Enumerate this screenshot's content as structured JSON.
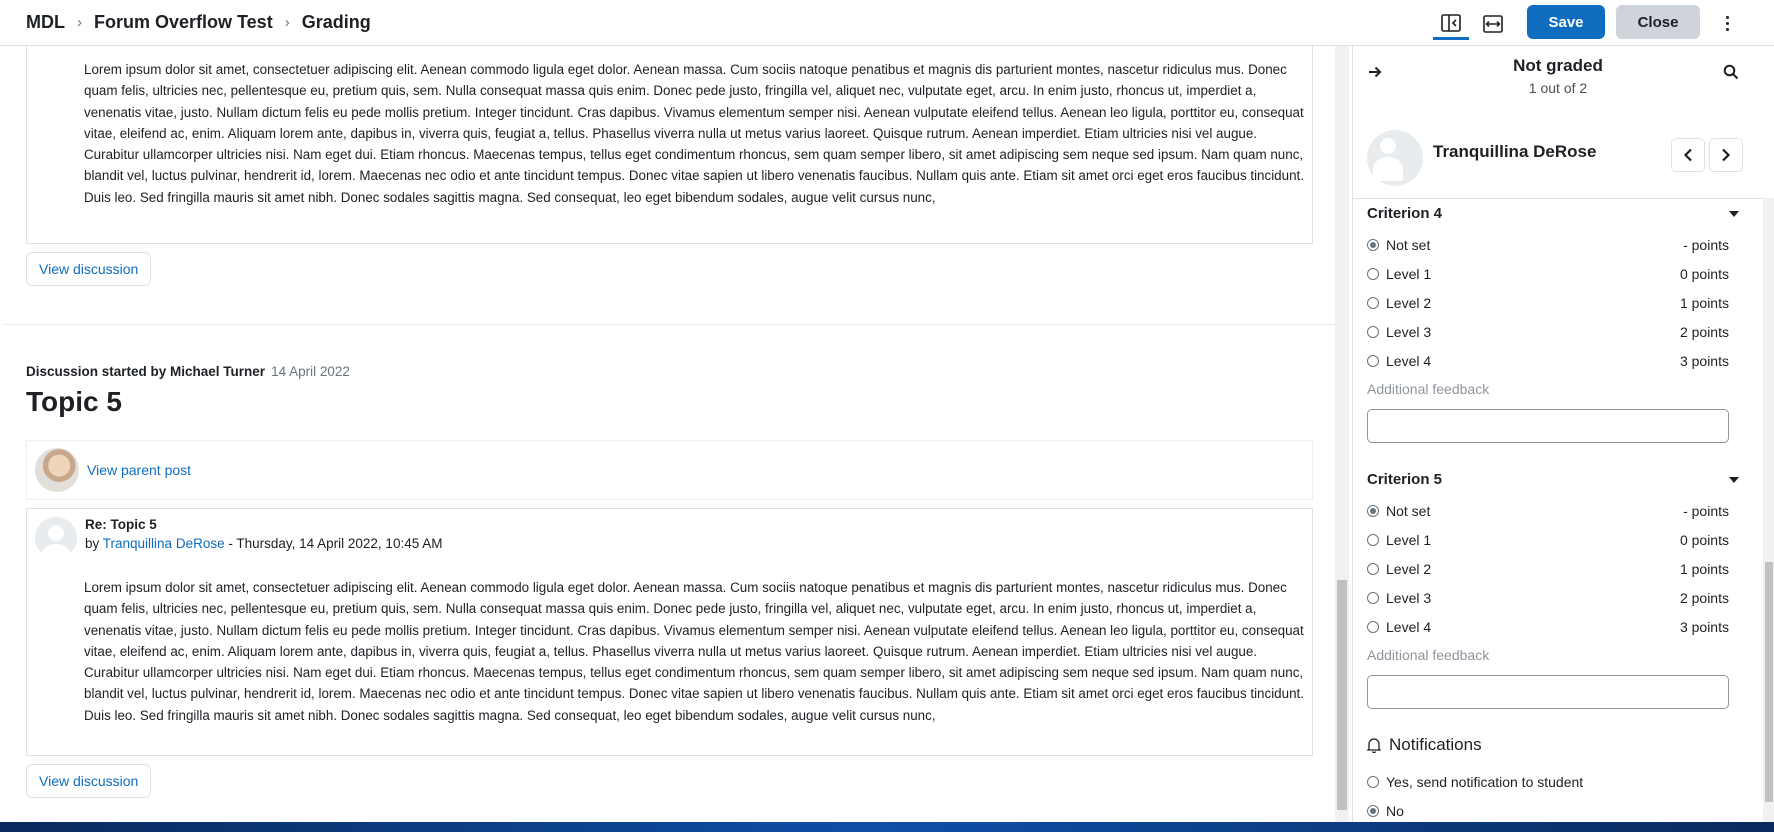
{
  "header": {
    "breadcrumb": [
      "MDL",
      "Forum Overflow Test",
      "Grading"
    ],
    "save_label": "Save",
    "close_label": "Close"
  },
  "main": {
    "post1_body": "Lorem ipsum dolor sit amet, consectetuer adipiscing elit. Aenean commodo ligula eget dolor. Aenean massa. Cum sociis natoque penatibus et magnis dis parturient montes, nascetur ridiculus mus. Donec quam felis, ultricies nec, pellentesque eu, pretium quis, sem. Nulla consequat massa quis enim. Donec pede justo, fringilla vel, aliquet nec, vulputate eget, arcu. In enim justo, rhoncus ut, imperdiet a, venenatis vitae, justo. Nullam dictum felis eu pede mollis pretium. Integer tincidunt. Cras dapibus. Vivamus elementum semper nisi. Aenean vulputate eleifend tellus. Aenean leo ligula, porttitor eu, consequat vitae, eleifend ac, enim. Aliquam lorem ante, dapibus in, viverra quis, feugiat a, tellus. Phasellus viverra nulla ut metus varius laoreet. Quisque rutrum. Aenean imperdiet. Etiam ultricies nisi vel augue. Curabitur ullamcorper ultricies nisi. Nam eget dui. Etiam rhoncus. Maecenas tempus, tellus eget condimentum rhoncus, sem quam semper libero, sit amet adipiscing sem neque sed ipsum. Nam quam nunc, blandit vel, luctus pulvinar, hendrerit id, lorem. Maecenas nec odio et ante tincidunt tempus. Donec vitae sapien ut libero venenatis faucibus. Nullam quis ante. Etiam sit amet orci eget eros faucibus tincidunt. Duis leo. Sed fringilla mauris sit amet nibh. Donec sodales sagittis magna. Sed consequat, leo eget bibendum sodales, augue velit cursus nunc,",
    "view_discussion_label": "View discussion",
    "discussion_started_by": "Discussion started by Michael Turner",
    "discussion_date": "14 April 2022",
    "topic_title": "Topic 5",
    "view_parent_post": "View parent post",
    "post2_title": "Re: Topic 5",
    "post2_by": "by",
    "post2_author": "Tranquillina DeRose",
    "post2_date": " - Thursday, 14 April 2022, 10:45 AM",
    "post2_body": "Lorem ipsum dolor sit amet, consectetuer adipiscing elit. Aenean commodo ligula eget dolor. Aenean massa. Cum sociis natoque penatibus et magnis dis parturient montes, nascetur ridiculus mus. Donec quam felis, ultricies nec, pellentesque eu, pretium quis, sem. Nulla consequat massa quis enim. Donec pede justo, fringilla vel, aliquet nec, vulputate eget, arcu. In enim justo, rhoncus ut, imperdiet a, venenatis vitae, justo. Nullam dictum felis eu pede mollis pretium. Integer tincidunt. Cras dapibus. Vivamus elementum semper nisi. Aenean vulputate eleifend tellus. Aenean leo ligula, porttitor eu, consequat vitae, eleifend ac, enim. Aliquam lorem ante, dapibus in, viverra quis, feugiat a, tellus. Phasellus viverra nulla ut metus varius laoreet. Quisque rutrum. Aenean imperdiet. Etiam ultricies nisi vel augue. Curabitur ullamcorper ultricies nisi. Nam eget dui. Etiam rhoncus. Maecenas tempus, tellus eget condimentum rhoncus, sem quam semper libero, sit amet adipiscing sem neque sed ipsum. Nam quam nunc, blandit vel, luctus pulvinar, hendrerit id, lorem. Maecenas nec odio et ante tincidunt tempus. Donec vitae sapien ut libero venenatis faucibus. Nullam quis ante. Etiam sit amet orci eget eros faucibus tincidunt. Duis leo. Sed fringilla mauris sit amet nibh. Donec sodales sagittis magna. Sed consequat, leo eget bibendum sodales, augue velit cursus nunc,"
  },
  "panel": {
    "status": "Not graded",
    "position": "1 out of 2",
    "user_name": "Tranquillina DeRose",
    "criteria": [
      {
        "title": "Criterion 4",
        "options": [
          {
            "label": "Not set",
            "points": "- points",
            "checked": true
          },
          {
            "label": "Level 1",
            "points": "0 points",
            "checked": false
          },
          {
            "label": "Level 2",
            "points": "1 points",
            "checked": false
          },
          {
            "label": "Level 3",
            "points": "2 points",
            "checked": false
          },
          {
            "label": "Level 4",
            "points": "3 points",
            "checked": false
          }
        ],
        "feedback_label": "Additional feedback",
        "feedback_value": ""
      },
      {
        "title": "Criterion 5",
        "options": [
          {
            "label": "Not set",
            "points": "- points",
            "checked": true
          },
          {
            "label": "Level 1",
            "points": "0 points",
            "checked": false
          },
          {
            "label": "Level 2",
            "points": "1 points",
            "checked": false
          },
          {
            "label": "Level 3",
            "points": "2 points",
            "checked": false
          },
          {
            "label": "Level 4",
            "points": "3 points",
            "checked": false
          }
        ],
        "feedback_label": "Additional feedback",
        "feedback_value": ""
      }
    ],
    "notifications": {
      "title": "Notifications",
      "options": [
        {
          "label": "Yes, send notification to student",
          "checked": false
        },
        {
          "label": "No",
          "checked": true
        }
      ]
    }
  },
  "colors": {
    "primary": "#0f6cbf",
    "secondary_button": "#ced4da",
    "text": "#1d2125",
    "muted": "#6a737b"
  }
}
